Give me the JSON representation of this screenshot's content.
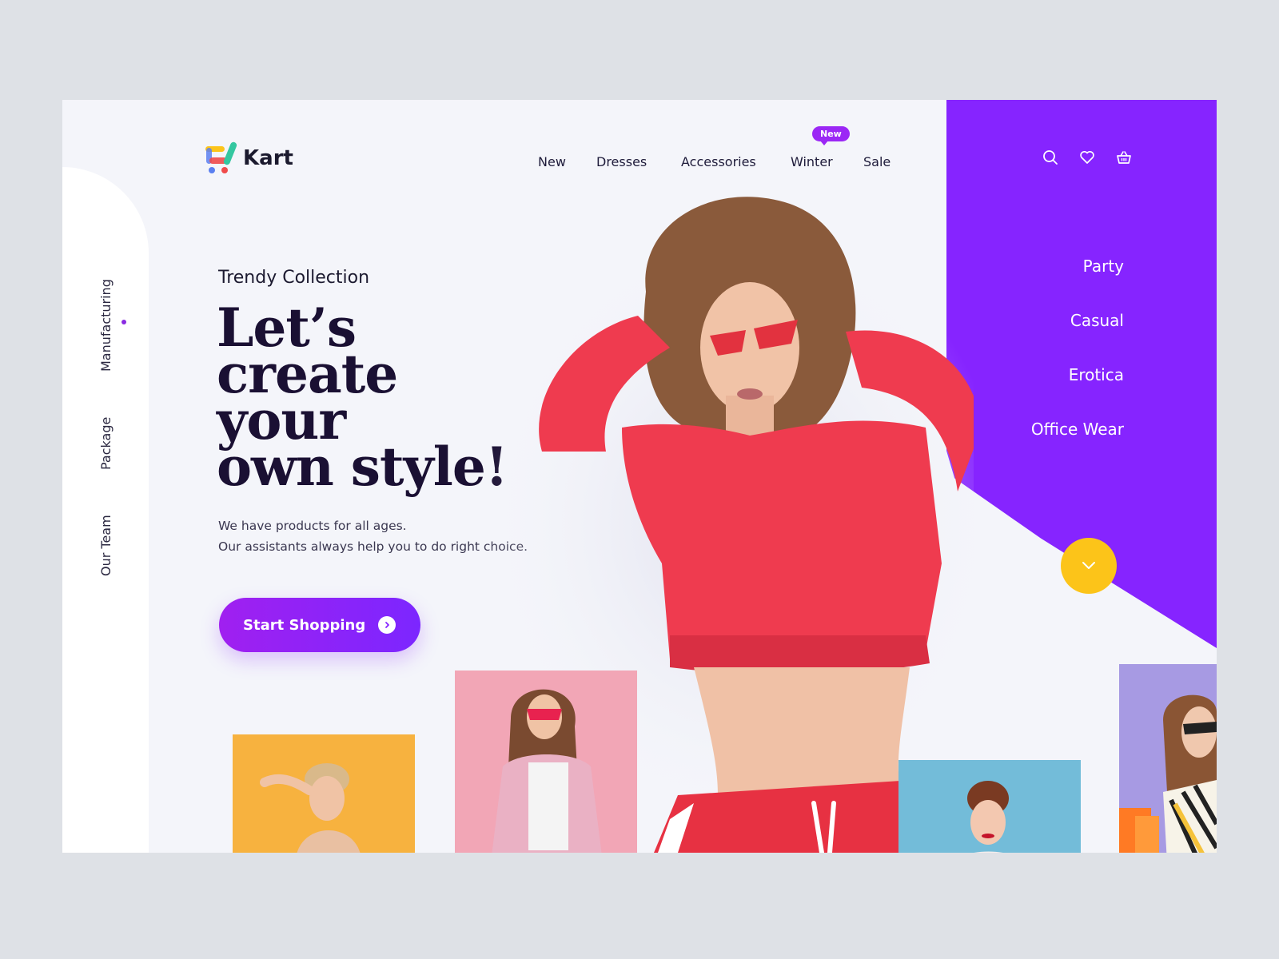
{
  "brand": {
    "name": "Kart",
    "colors": {
      "accent": "#8624ff",
      "yellow": "#fcc419",
      "dark": "#1a1033",
      "background": "#f4f5fa"
    }
  },
  "nav": {
    "items": [
      {
        "label": "New"
      },
      {
        "label": "Dresses"
      },
      {
        "label": "Accessories"
      },
      {
        "label": "Winter",
        "badge": "New"
      },
      {
        "label": "Sale"
      }
    ]
  },
  "header_icons": [
    "search-icon",
    "heart-icon",
    "basket-icon"
  ],
  "side_nav": {
    "items": [
      "Manufacturing",
      "Package",
      "Our Team"
    ],
    "active": "Manufacturing"
  },
  "hero": {
    "eyebrow": "Trendy Collection",
    "headline_lines": [
      "Let’s",
      "create",
      "your",
      "own style!"
    ],
    "subtext_lines": [
      "We have products for all ages.",
      "Our assistants always help you to do right choice."
    ],
    "cta_label": "Start Shopping"
  },
  "categories": [
    "Party",
    "Casual",
    "Erotica",
    "Office Wear"
  ],
  "thumbnails": [
    {
      "name": "yellow-background-model",
      "bg": "#f7b23f"
    },
    {
      "name": "pink-background-model",
      "bg": "#f2a6b6"
    },
    {
      "name": "blue-background-model",
      "bg": "#73bcd9"
    },
    {
      "name": "lilac-background-model",
      "bg": "#a79ae3"
    }
  ]
}
